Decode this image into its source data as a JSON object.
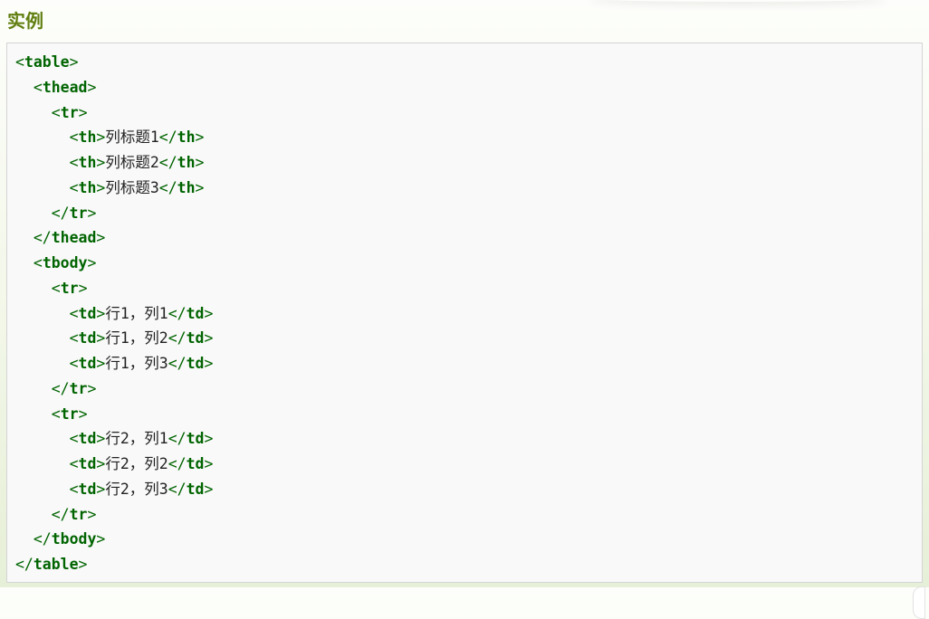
{
  "heading": "实例",
  "lines": [
    {
      "indent": "",
      "open": "table",
      "text": "",
      "close": ""
    },
    {
      "indent": "  ",
      "open": "thead",
      "text": "",
      "close": ""
    },
    {
      "indent": "    ",
      "open": "tr",
      "text": "",
      "close": ""
    },
    {
      "indent": "      ",
      "open": "th",
      "text": "列标题1",
      "close": "th"
    },
    {
      "indent": "      ",
      "open": "th",
      "text": "列标题2",
      "close": "th"
    },
    {
      "indent": "      ",
      "open": "th",
      "text": "列标题3",
      "close": "th"
    },
    {
      "indent": "    ",
      "open": "",
      "text": "",
      "close": "tr"
    },
    {
      "indent": "  ",
      "open": "",
      "text": "",
      "close": "thead"
    },
    {
      "indent": "  ",
      "open": "tbody",
      "text": "",
      "close": ""
    },
    {
      "indent": "    ",
      "open": "tr",
      "text": "",
      "close": ""
    },
    {
      "indent": "      ",
      "open": "td",
      "text": "行1，列1",
      "close": "td"
    },
    {
      "indent": "      ",
      "open": "td",
      "text": "行1，列2",
      "close": "td"
    },
    {
      "indent": "      ",
      "open": "td",
      "text": "行1，列3",
      "close": "td"
    },
    {
      "indent": "    ",
      "open": "",
      "text": "",
      "close": "tr"
    },
    {
      "indent": "    ",
      "open": "tr",
      "text": "",
      "close": ""
    },
    {
      "indent": "      ",
      "open": "td",
      "text": "行2，列1",
      "close": "td"
    },
    {
      "indent": "      ",
      "open": "td",
      "text": "行2，列2",
      "close": "td"
    },
    {
      "indent": "      ",
      "open": "td",
      "text": "行2，列3",
      "close": "td"
    },
    {
      "indent": "    ",
      "open": "",
      "text": "",
      "close": "tr"
    },
    {
      "indent": "  ",
      "open": "",
      "text": "",
      "close": "tbody"
    },
    {
      "indent": "",
      "open": "",
      "text": "",
      "close": "table"
    }
  ],
  "colors": {
    "heading": "#617f10",
    "tag": "#006400",
    "box_background": "#f9f9f9",
    "box_border": "#d4d4d4"
  }
}
